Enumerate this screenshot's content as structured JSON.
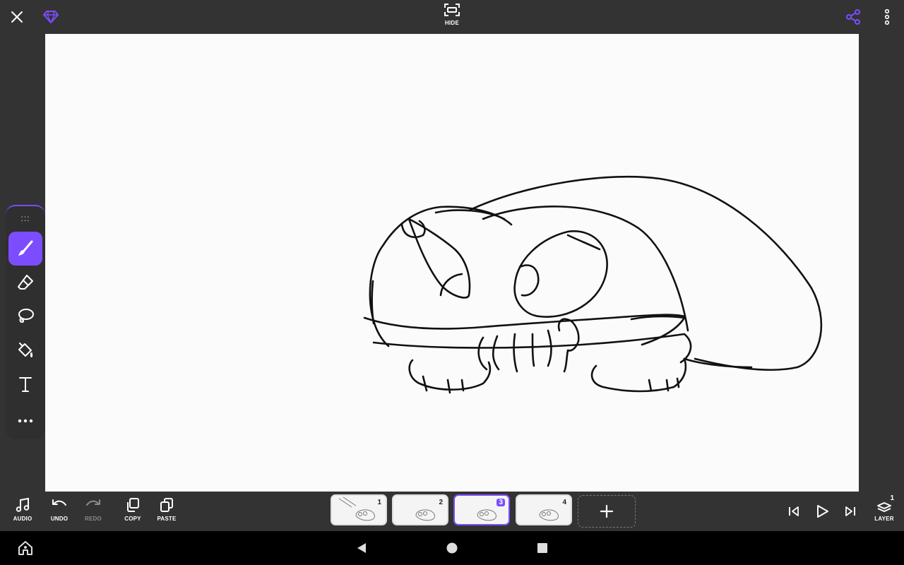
{
  "colors": {
    "accent": "#7c4dff",
    "bar": "#333333",
    "canvas": "#fbfbfb",
    "navbar": "#000000"
  },
  "topbar": {
    "close_icon": "close-icon",
    "premium_icon": "diamond-icon",
    "hide_label": "HIDE",
    "share_icon": "share-icon",
    "menu_icon": "more-vertical-icon"
  },
  "toolbox": {
    "grip": ":::",
    "tools": [
      {
        "name": "brush",
        "icon": "brush-icon",
        "active": true
      },
      {
        "name": "eraser",
        "icon": "eraser-icon",
        "active": false
      },
      {
        "name": "lasso",
        "icon": "lasso-icon",
        "active": false
      },
      {
        "name": "fill",
        "icon": "paint-bucket-icon",
        "active": false
      },
      {
        "name": "text",
        "icon": "text-icon",
        "active": false
      },
      {
        "name": "more",
        "icon": "more-horizontal-icon",
        "active": false
      }
    ]
  },
  "bottom": {
    "audio": "AUDIO",
    "undo": "UNDO",
    "redo": "REDO",
    "copy": "COPY",
    "paste": "PASTE",
    "layer": "LAYER",
    "layer_count": "1"
  },
  "frames": [
    {
      "number": "1",
      "selected": false
    },
    {
      "number": "2",
      "selected": false
    },
    {
      "number": "3",
      "selected": true
    },
    {
      "number": "4",
      "selected": false
    }
  ],
  "playback": {
    "first_icon": "skip-to-start-icon",
    "play_icon": "play-icon",
    "last_icon": "skip-to-end-icon"
  },
  "navbar": {
    "home_icon": "home-icon",
    "back_icon": "back-icon",
    "circle_icon": "home-circle-icon",
    "recents_icon": "recents-icon"
  }
}
